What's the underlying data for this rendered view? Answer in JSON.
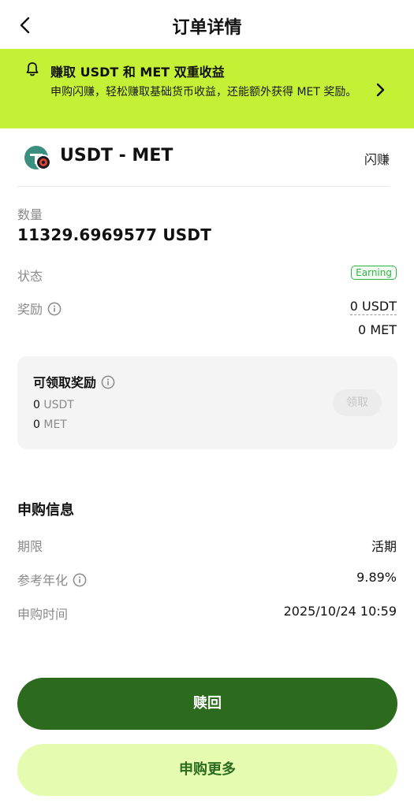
{
  "header": {
    "title": "订单详情",
    "back_icon": "chevron-left-icon"
  },
  "banner": {
    "bg_color": "#c4f135",
    "icon": "bell-icon",
    "title": "赚取 USDT 和 MET 双重收益",
    "desc": "申购闪赚，轻松赚取基础货币收益，还能额外获得 MET 奖励。",
    "arrow_icon": "chevron-right-icon"
  },
  "product": {
    "pair": "USDT - MET",
    "tag": "闪赚",
    "icon": "usdt-met-token-icon"
  },
  "amount": {
    "label": "数量",
    "value": "11329.6969577 USDT"
  },
  "status": {
    "label": "状态",
    "value": "Earning",
    "color": "#35b24a"
  },
  "reward": {
    "label": "奖励",
    "usdt": "0 USDT",
    "met": "0 MET"
  },
  "claimable": {
    "title": "可领取奖励",
    "usdt_amount": "0",
    "usdt_unit": "USDT",
    "met_amount": "0",
    "met_unit": "MET",
    "claim_label": "领取"
  },
  "subscription": {
    "title": "申购信息",
    "term_label": "期限",
    "term_value": "活期",
    "apr_label": "参考年化",
    "apr_value": "9.89%",
    "time_label": "申购时间",
    "time_value": "2025/10/24 10:59"
  },
  "actions": {
    "redeem_label": "赎回",
    "subscribe_more_label": "申购更多",
    "primary_color": "#2c6b1d",
    "secondary_color": "#e4fbb0"
  }
}
